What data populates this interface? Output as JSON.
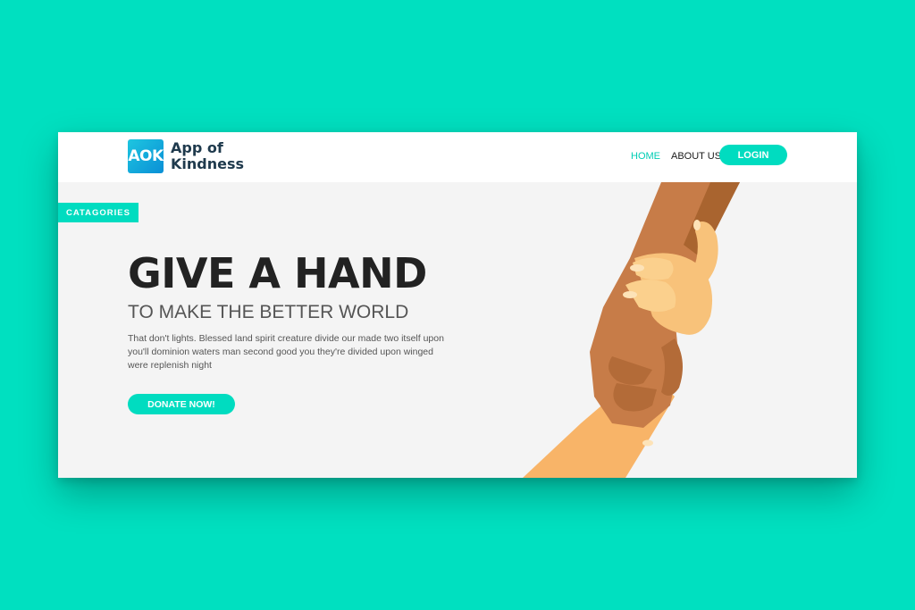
{
  "logo": {
    "mark": "AOK",
    "line1": "App of",
    "line2": "Kindness"
  },
  "nav": {
    "home": "HOME",
    "about": "ABOUT US",
    "login": "LOGIN"
  },
  "tag": "CATAGORIES",
  "hero": {
    "title": "GIVE A HAND",
    "subtitle": "TO MAKE THE BETTER WORLD",
    "description": "That don't lights. Blessed land spirit creature divide our made two itself upon you'll dominion waters man second good you they're divided upon winged were replenish night",
    "cta": "DONATE NOW!"
  },
  "colors": {
    "background": "#00e0c0",
    "accent": "#00dcc0",
    "active_nav": "#00cdb4"
  },
  "illustration": "helping-hands-illustration"
}
